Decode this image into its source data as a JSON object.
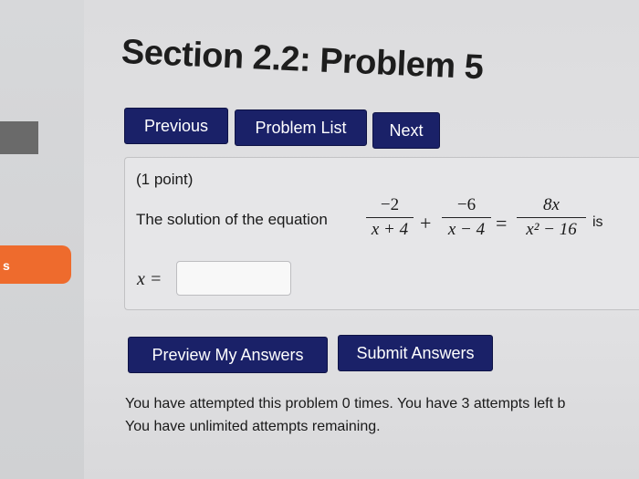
{
  "sidebar": {
    "badge_label": "s"
  },
  "page": {
    "title": "Section 2.2: Problem 5"
  },
  "nav": {
    "previous_label": "Previous",
    "problem_list_label": "Problem List",
    "next_label": "Next"
  },
  "problem": {
    "points": "(1 point)",
    "prompt": "The solution of the equation",
    "suffix": "is",
    "fractions": [
      {
        "num": "−2",
        "den": "x + 4"
      },
      {
        "num": "−6",
        "den": "x − 4"
      },
      {
        "num": "8x",
        "den": "x² − 16"
      }
    ],
    "plus": "+",
    "equals": "=",
    "answer_label": "x =",
    "answer_value": ""
  },
  "actions": {
    "preview_label": "Preview My Answers",
    "submit_label": "Submit Answers"
  },
  "status": {
    "attempts_line": "You have attempted this problem 0 times. You have 3 attempts left b",
    "remaining_line": "You have unlimited attempts remaining."
  },
  "colors": {
    "button_bg": "#1a2168",
    "accent_orange": "#ee6b2d"
  }
}
